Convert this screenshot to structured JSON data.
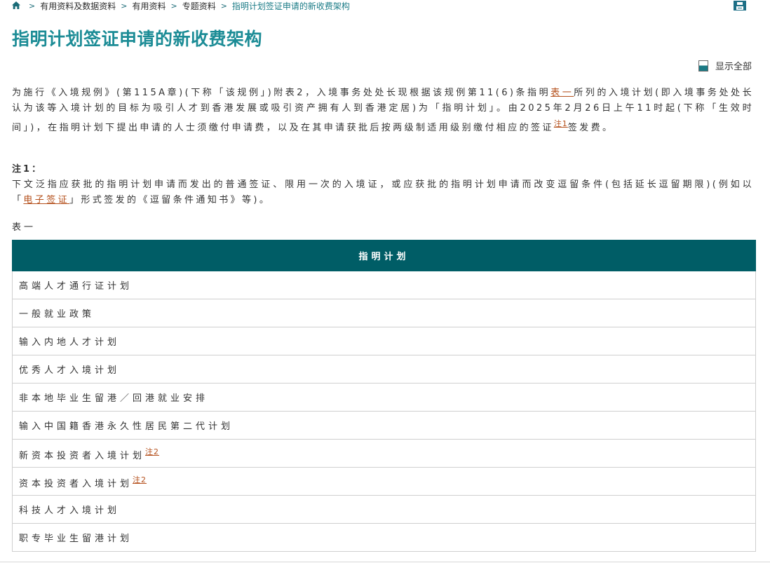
{
  "breadcrumb": {
    "items": [
      "有用资料及数据资料",
      "有用资料",
      "专题资料"
    ],
    "current": "指明计划签证申请的新收费架构",
    "separator": ">"
  },
  "page": {
    "title": "指明计划签证申请的新收费架构",
    "show_all": "显示全部"
  },
  "intro": {
    "t1": "为施行《入境规例》(第115A章)(下称「该规例」)附表2，入境事务处处长现根据该规例第11(6)条指明",
    "link_table": "表一",
    "t2": "所列的入境计划(即入境事务处处长认为该等入境计划的目标为吸引人才到香港发展或吸引资产拥有人到香港定居)为「指明计划」。由2025年2月26日上午11时起(下称「生效时间」)，在指明计划下提出申请的人士须缴付申请费，以及在其申请获批后按两级制适用级别缴付相应的签证",
    "note_link": "注1",
    "t3": "签发费。"
  },
  "note1": {
    "title": "注1：",
    "t1": "下文泛指应获批的指明计划申请而发出的普通签证、限用一次的入境证，或应获批的指明计划申请而改变逗留条件(包括延长逗留期限)(例如以「",
    "link": "电子签证",
    "t2": "」形式签发的《逗留条件通知书》等)。"
  },
  "table": {
    "caption": "表一",
    "header": "指明计划",
    "rows": [
      {
        "name": "高端人才通行证计划",
        "note": ""
      },
      {
        "name": "一般就业政策",
        "note": ""
      },
      {
        "name": "输入内地人才计划",
        "note": ""
      },
      {
        "name": "优秀人才入境计划",
        "note": ""
      },
      {
        "name": "非本地毕业生留港／回港就业安排",
        "note": ""
      },
      {
        "name": "输入中国籍香港永久性居民第二代计划",
        "note": ""
      },
      {
        "name": "新资本投资者入境计划",
        "note": "注2"
      },
      {
        "name": "资本投资者入境计划",
        "note": "注2"
      },
      {
        "name": "科技人才入境计划",
        "note": ""
      },
      {
        "name": "职专毕业生留港计划",
        "note": ""
      }
    ]
  },
  "colors": {
    "title": "#1c8c96",
    "table_header": "#005d66",
    "link": "#b5511d"
  },
  "icons": [
    "home-icon",
    "print-icon",
    "show-all-toggle"
  ]
}
